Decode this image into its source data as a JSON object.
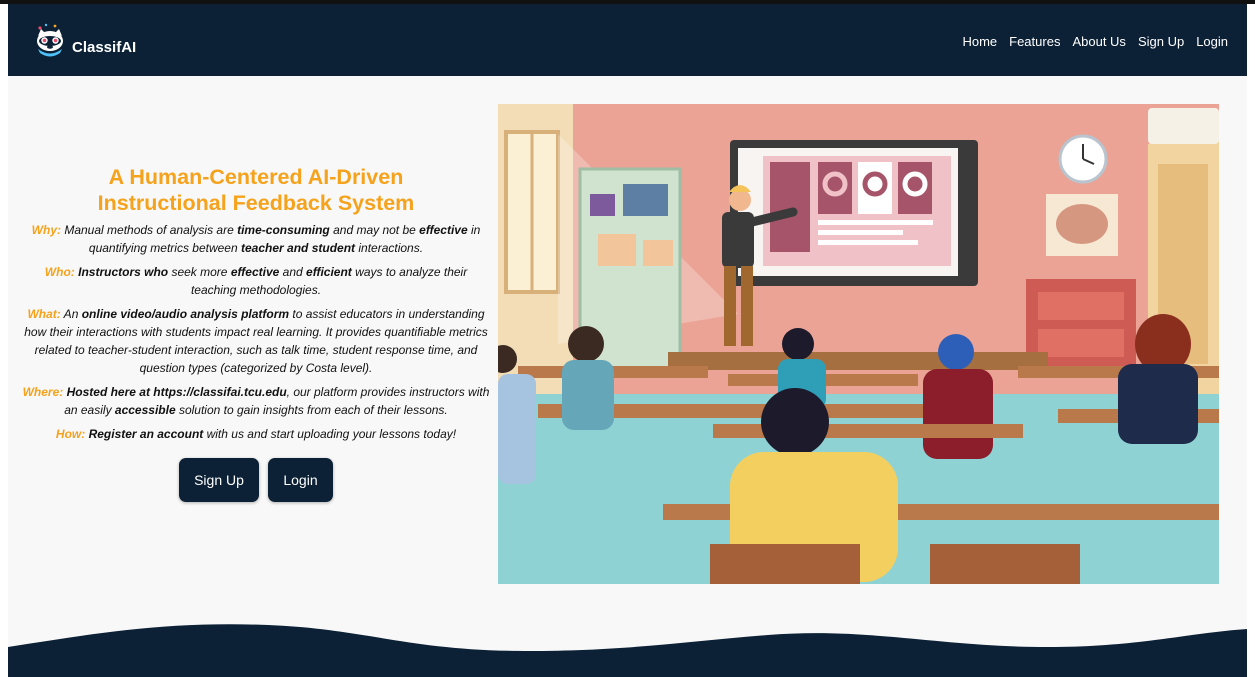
{
  "brand": {
    "name": "ClassifAI"
  },
  "nav": {
    "links": [
      "Home",
      "Features",
      "About Us",
      "Sign Up",
      "Login"
    ]
  },
  "hero": {
    "title_line1": "A Human-Centered AI-Driven",
    "title_line2": "Instructional Feedback System",
    "why": {
      "label": "Why:",
      "t1": " Manual methods of analysis are ",
      "b1": "time-consuming",
      "t2": " and may not be ",
      "b2": "effective",
      "t3": " in quantifying metrics between ",
      "b3": "teacher and student",
      "t4": " interactions."
    },
    "who": {
      "label": "Who:",
      "b1": " Instructors who",
      "t1": " seek more ",
      "b2": "effective",
      "t2": " and ",
      "b3": "efficient",
      "t3": " ways to analyze their teaching methodologies."
    },
    "what": {
      "label": "What:",
      "t1": " An ",
      "b1": "online video/audio analysis platform",
      "t2": " to assist educators in understanding how their interactions with students impact real learning. It provides quantifiable metrics related to teacher-student interaction, such as talk time, student response time, and question types (categorized by Costa level)."
    },
    "where": {
      "label": "Where:",
      "b1": " Hosted here at https://classifai.tcu.edu",
      "t1": ", our platform provides instructors with an easily ",
      "b2": "accessible",
      "t2": " solution to gain insights from each of their lessons."
    },
    "how": {
      "label": "How:",
      "b1": " Register an account",
      "t1": " with us and start uploading your lessons today!"
    },
    "buttons": {
      "signup": "Sign Up",
      "login": "Login"
    }
  },
  "colors": {
    "navy": "#0c2136",
    "accent": "#f5a21c",
    "background": "#f8f8f8"
  },
  "icons": {
    "logo": "raccoon-mascot-icon"
  }
}
